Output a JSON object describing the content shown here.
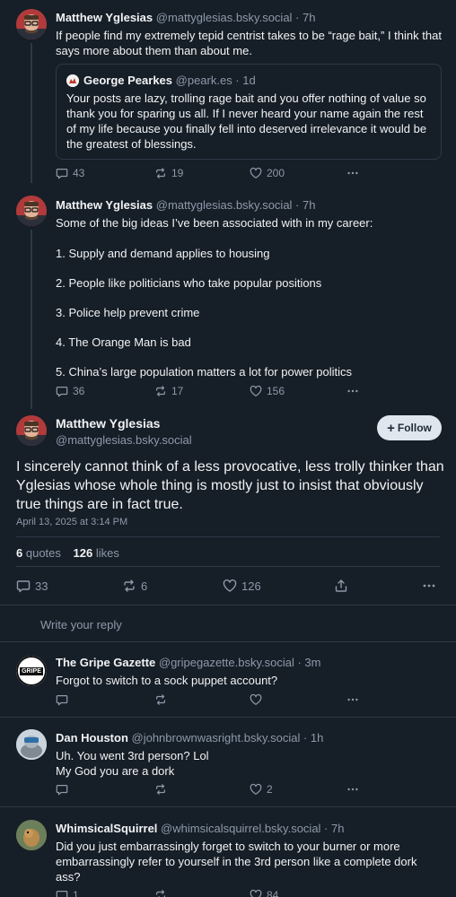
{
  "posts": [
    {
      "author": "Matthew Yglesias",
      "handle": "@mattyglesias.bsky.social · 7h",
      "text": "If people find my extremely tepid centrist takes to be “rage bait,” I think that says more about them than about me.",
      "quote": {
        "author": "George Pearkes",
        "handle": "@peark.es · 1d",
        "text": "Your posts are lazy, trolling rage bait and you offer nothing of value so thank you for sparing us all. If I never heard your name again the rest of my life because you finally fell into deserved irrelevance it would be the greatest of blessings."
      },
      "replies": "43",
      "reposts": "19",
      "likes": "200"
    },
    {
      "author": "Matthew Yglesias",
      "handle": "@mattyglesias.bsky.social · 7h",
      "text": "Some of the big ideas I’ve been associated with in my career:",
      "list": [
        "1. Supply and demand applies to housing",
        "2. People like politicians who take popular positions",
        "3. Police help prevent crime",
        "4. The Orange Man is bad",
        "5. China’s large population matters a lot for power politics"
      ],
      "replies": "36",
      "reposts": "17",
      "likes": "156"
    }
  ],
  "main": {
    "author": "Matthew Yglesias",
    "handle": "@mattyglesias.bsky.social",
    "follow_label": "Follow",
    "text": "I sincerely cannot think of a less provocative, less trolly thinker than Yglesias whose whole thing is mostly just to insist that obviously true things are in fact true.",
    "timestamp": "April 13, 2025 at 3:14 PM",
    "quotes_count": "6",
    "quotes_label": "quotes",
    "likes_count": "126",
    "likes_label": "likes",
    "replies": "33",
    "reposts": "6",
    "likes": "126"
  },
  "reply_placeholder": "Write your reply",
  "replies": [
    {
      "author": "The Gripe Gazette",
      "handle": "@gripegazette.bsky.social · 3m",
      "text": "Forgot to switch to a sock puppet account?",
      "replies": "",
      "reposts": "",
      "likes": ""
    },
    {
      "author": "Dan Houston",
      "handle": "@johnbrownwasright.bsky.social · 1h",
      "text": "Uh. You went 3rd person? Lol",
      "text2": "My God you are a dork",
      "replies": "",
      "reposts": "",
      "likes": "2"
    },
    {
      "author": "WhimsicalSquirrel",
      "handle": "@whimsicalsquirrel.bsky.social · 7h",
      "text": "Did you just embarrassingly forget to switch to your burner or more embarrassingly refer to yourself in the 3rd person like a complete dork ass?",
      "replies": "1",
      "reposts": "",
      "likes": "84"
    }
  ],
  "avatars": {
    "gripe_text": "GRIPE"
  },
  "colors": {
    "background": "#161e27",
    "border": "#2e3947",
    "muted": "#8d9aab",
    "follow_bg": "#dfe6ee"
  }
}
